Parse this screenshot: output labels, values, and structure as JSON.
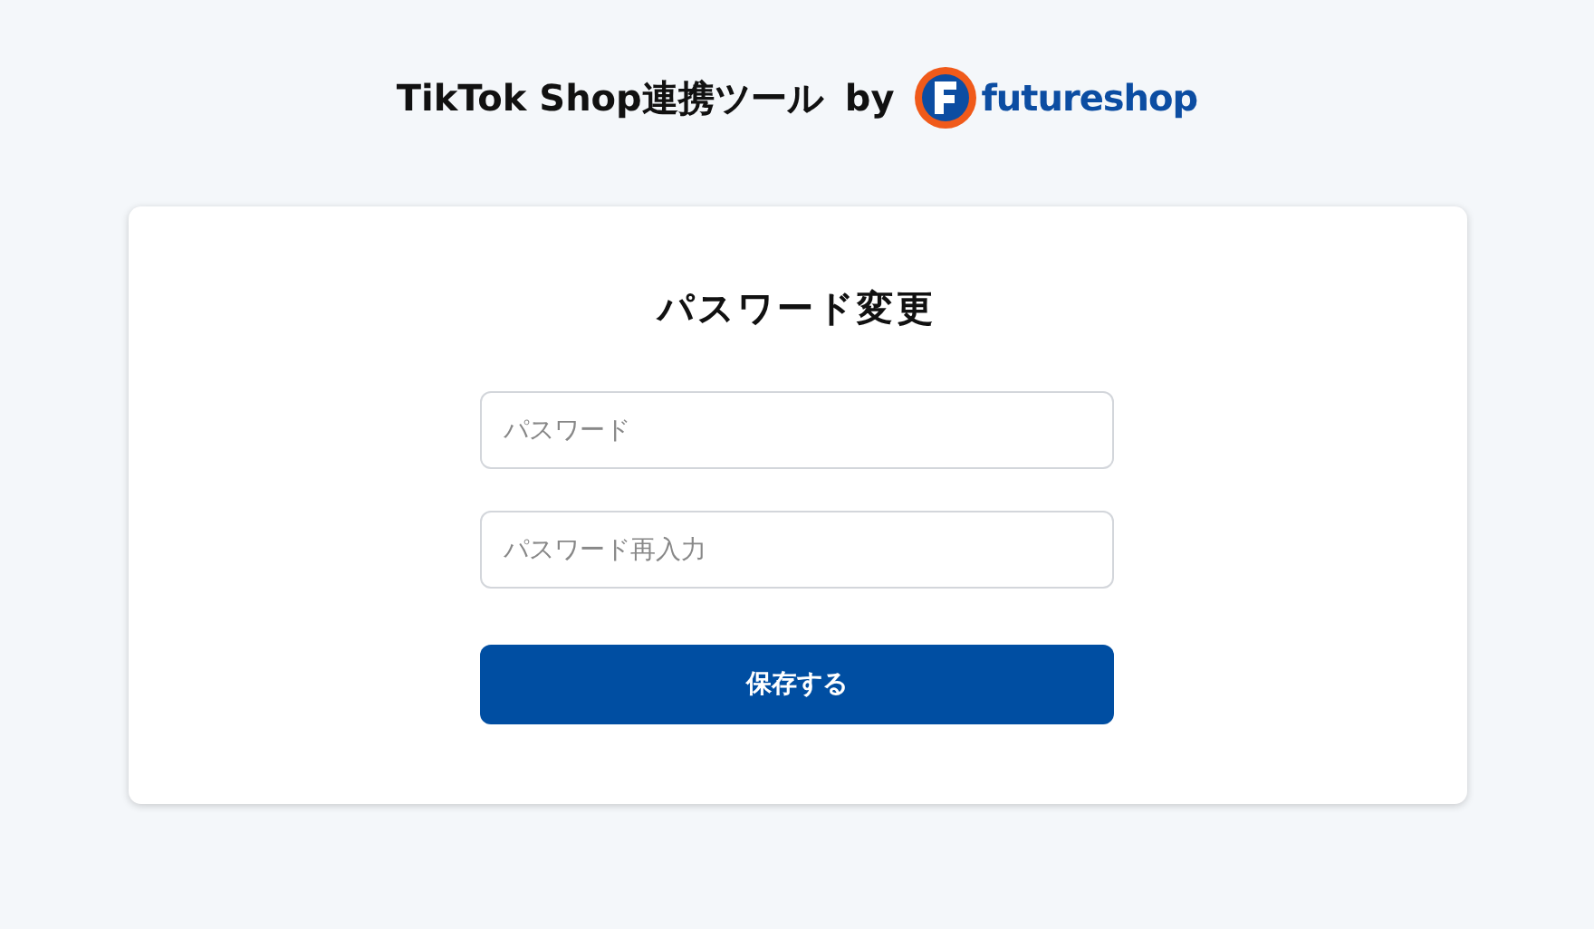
{
  "header": {
    "title": "TikTok Shop連携ツール",
    "by": "by",
    "logo_text": "futureshop"
  },
  "card": {
    "heading": "パスワード変更",
    "fields": [
      {
        "placeholder": "パスワード"
      },
      {
        "placeholder": "パスワード再入力"
      }
    ],
    "button": "保存する"
  }
}
